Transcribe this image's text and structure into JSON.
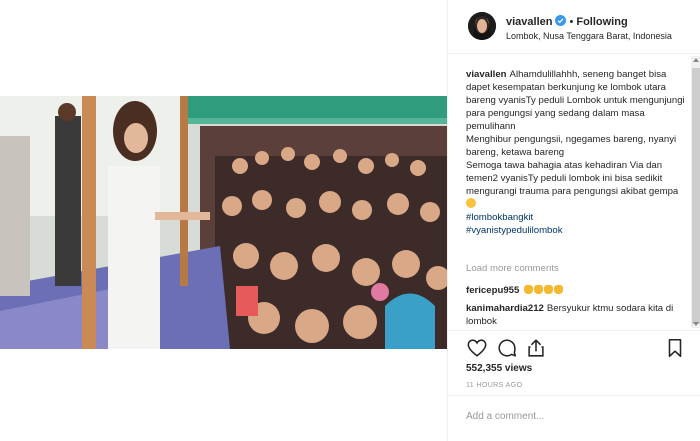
{
  "post": {
    "username": "viavallen",
    "follow_status": "Following",
    "location": "Lombok, Nusa Tenggara Barat, Indonesia",
    "caption": {
      "username": "viavallen",
      "line1": "Alhamdulillahhh, seneng banget bisa dapet kesempatan berkunjung ke lombok utara bareng vyanisTy peduli Lombok untuk mengunjungi para pengungsi yang sedang dalam masa pemulihann",
      "line2": "Menghibur pengungsii, ngegames bareng, nyanyi bareng, ketawa bareng",
      "line3": "Semoga tawa bahagia atas kehadiran Via dan temen2 vyanisTy peduli lombok ini bisa sedikit mengurangi trauma para pengungsi akibat gempa",
      "hashtags": [
        "#lombokbangkit",
        "#vyanistypedulilombok"
      ]
    },
    "load_more": "Load more comments",
    "comments": [
      {
        "user": "fericepu955",
        "text": ""
      },
      {
        "user": "kanimahardia212",
        "text": "Bersyukur ktmu sodara kita di lombok"
      }
    ],
    "views": "552,355 views",
    "timestamp": "11 HOURS AGO",
    "add_comment_placeholder": "Add a comment...",
    "icons": {
      "like": "heart-icon",
      "comment": "comment-icon",
      "share": "share-icon",
      "save": "bookmark-icon",
      "verified": "verified-badge-icon"
    },
    "colors": {
      "verified": "#3897f0",
      "hashtag": "#003569",
      "muted": "#999999"
    }
  }
}
